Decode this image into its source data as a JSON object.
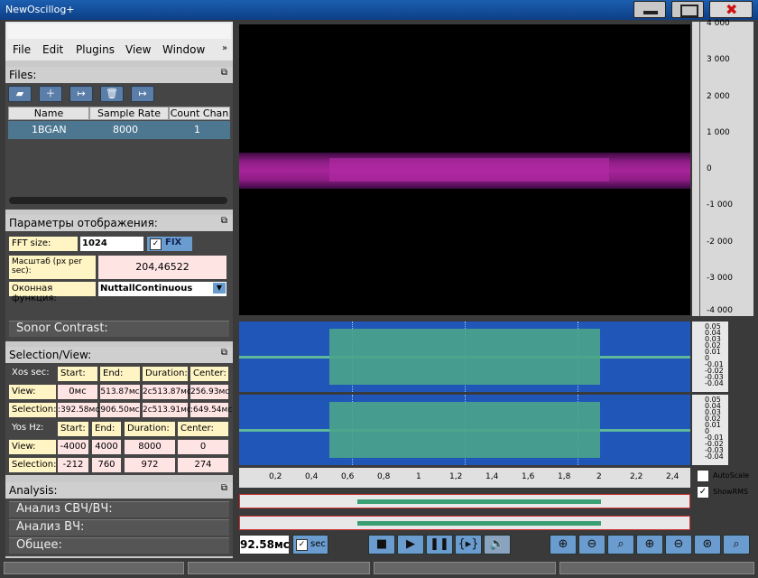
{
  "window": {
    "title": "NewOscillog+"
  },
  "menu": {
    "items": [
      "File",
      "Edit",
      "Plugins",
      "View",
      "Window"
    ],
    "overflow": "»"
  },
  "files": {
    "title": "Files:",
    "columns": [
      "Name",
      "Sample Rate",
      "Count Chan"
    ],
    "rows": [
      {
        "name": "1BGAN",
        "rate": "8000",
        "count": "1"
      }
    ]
  },
  "display": {
    "title": "Параметры отображения:",
    "fft_label": "FFT size:",
    "fft_value": "1024",
    "fix_label": "FIX",
    "scale_label": "Масштаб (px per sec):",
    "scale_value": "204,46522",
    "window_label": "Оконная функция:",
    "window_value": "NuttallContinuous",
    "contrast_label": "Sonor Contrast:"
  },
  "selection": {
    "title": "Selection/View:",
    "xos": {
      "label": "Xos sec:",
      "headers": [
        "Start:",
        "End:",
        "Duration:",
        "Center:"
      ],
      "view": {
        "label": "View:",
        "values": [
          "0мс",
          "513.87мс",
          "2c513.87мс",
          "256.93мс"
        ]
      },
      "sel": {
        "label": "Selection:",
        "values": ":392.58мс",
        "values2": [
          "906.50мс",
          "2c513.91мс",
          ":649.54мс"
        ]
      }
    },
    "yos": {
      "label": "Yos Hz:",
      "headers": [
        "Start:",
        "End:",
        "Duration:",
        "Center:"
      ],
      "view": {
        "label": "View:",
        "values": [
          "-4000",
          "4000",
          "8000",
          "0"
        ]
      },
      "sel": {
        "label": "Selection:",
        "values": [
          "-212",
          "760",
          "972",
          "274"
        ]
      }
    }
  },
  "analysis": {
    "title": "Analysis:",
    "items": [
      "Анализ СВЧ/ВЧ:",
      "Анализ ВЧ:",
      "Общее:"
    ]
  },
  "spectrogram": {
    "yticks": [
      "4 000",
      "3 000",
      "2 000",
      "1 000",
      "0",
      "-1 000",
      "-2 000",
      "-3 000",
      "-4 000"
    ]
  },
  "waveform": {
    "yticks": [
      "0.05",
      "0.04",
      "0.03",
      "0.02",
      "0.01",
      "0",
      "-0.01",
      "-0.02",
      "-0.03",
      "-0.04",
      "-0.05"
    ]
  },
  "timeaxis": {
    "ticks": [
      "0,2",
      "0,4",
      "0,6",
      "0,8",
      "1",
      "1,2",
      "1,4",
      "1,6",
      "1,8",
      "2",
      "2,2",
      "2,4"
    ]
  },
  "checks": {
    "autoscale": "AutoScale",
    "showrms": "ShowRMS"
  },
  "transport": {
    "time": "92.58мс",
    "sec_label": "sec"
  }
}
